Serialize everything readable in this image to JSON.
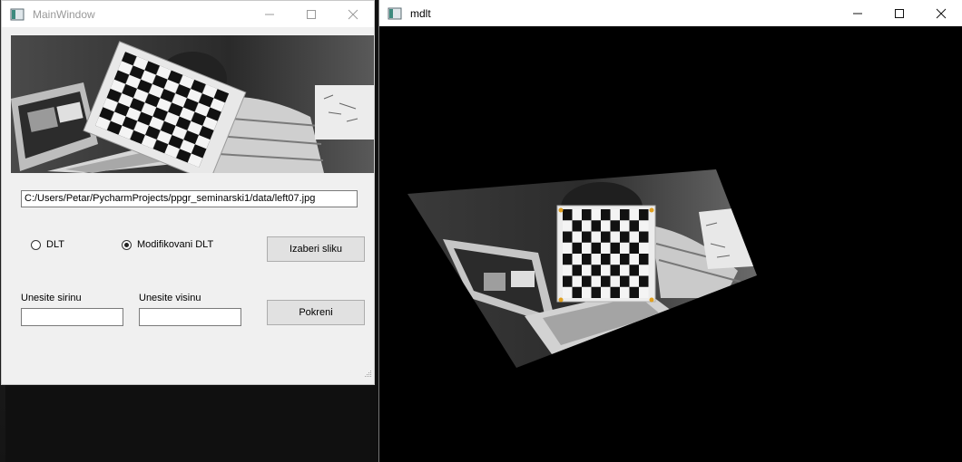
{
  "main_window": {
    "title": "MainWindow",
    "icon": "qt-window-icon",
    "path_value": "C:/Users/Petar/PycharmProjects/ppgr_seminarski1/data/left07.jpg",
    "radio_dlt_label": "DLT",
    "radio_dlt_checked": false,
    "radio_mod_dlt_label": "Modifikovani DLT",
    "radio_mod_dlt_checked": true,
    "choose_image_label": "Izaberi sliku",
    "width_label": "Unesite sirinu",
    "width_value": "",
    "height_label": "Unesite visinu",
    "height_value": "",
    "run_label": "Pokreni"
  },
  "mdlt_window": {
    "title": "mdlt",
    "icon": "qt-window-icon"
  },
  "colors": {
    "window_bg": "#f0f0f0",
    "button_bg": "#e1e1e1",
    "corner_marker": "#e0a020"
  }
}
